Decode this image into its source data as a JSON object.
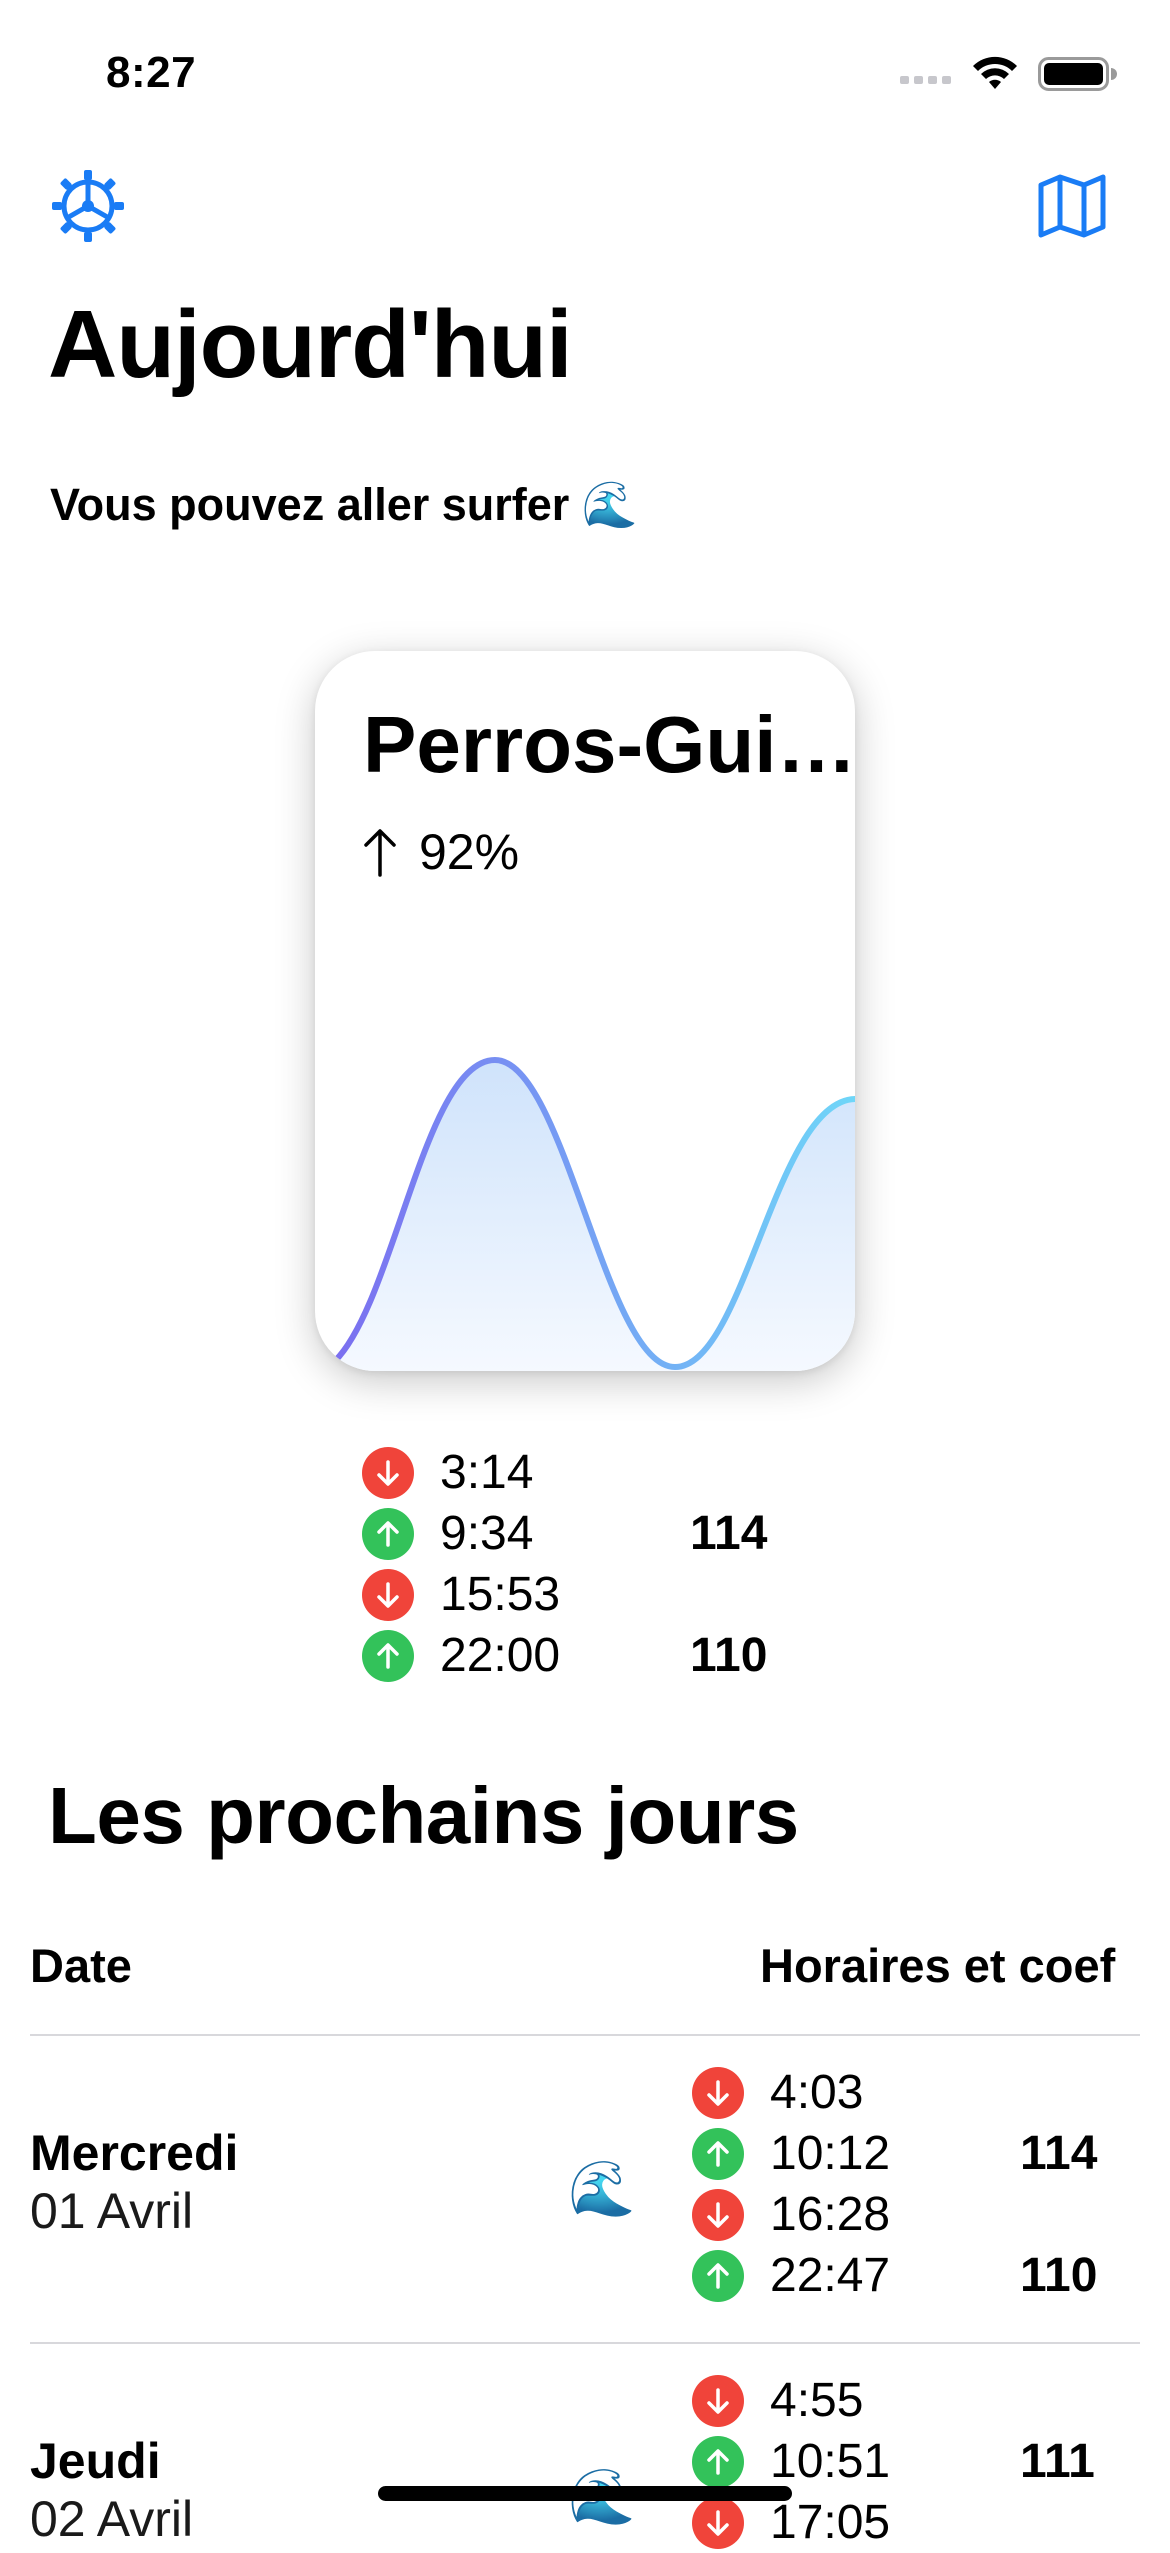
{
  "status_bar": {
    "time": "8:27"
  },
  "header": {
    "settings_icon": "gear-icon",
    "map_icon": "map-icon",
    "title": "Aujourd'hui",
    "subtitle": "Vous pouvez aller surfer 🌊"
  },
  "card": {
    "location": "Perros-Gui…",
    "percent": "92%",
    "direction_icon": "arrow-up-icon",
    "gradient_colors": [
      "#7b6ff0",
      "#6fd6f8"
    ]
  },
  "today_tides": [
    {
      "type": "low",
      "time": "3:14",
      "coef": ""
    },
    {
      "type": "high",
      "time": "9:34",
      "coef": "114"
    },
    {
      "type": "low",
      "time": "15:53",
      "coef": ""
    },
    {
      "type": "high",
      "time": "22:00",
      "coef": "110"
    }
  ],
  "colors": {
    "accent": "#1a7cf5",
    "low": "#f0443a",
    "high": "#33c25a"
  },
  "next_days": {
    "title": "Les prochains jours",
    "col_date": "Date",
    "col_times": "Horaires et coef",
    "days": [
      {
        "name": "Mercredi",
        "date": "01 Avril",
        "emoji": "🌊",
        "tides": [
          {
            "type": "low",
            "time": "4:03",
            "coef": ""
          },
          {
            "type": "high",
            "time": "10:12",
            "coef": "114"
          },
          {
            "type": "low",
            "time": "16:28",
            "coef": ""
          },
          {
            "type": "high",
            "time": "22:47",
            "coef": "110"
          }
        ]
      },
      {
        "name": "Jeudi",
        "date": "02 Avril",
        "emoji": "🌊",
        "tides": [
          {
            "type": "low",
            "time": "4:55",
            "coef": ""
          },
          {
            "type": "high",
            "time": "10:51",
            "coef": "111"
          },
          {
            "type": "low",
            "time": "17:05",
            "coef": ""
          }
        ]
      }
    ]
  }
}
